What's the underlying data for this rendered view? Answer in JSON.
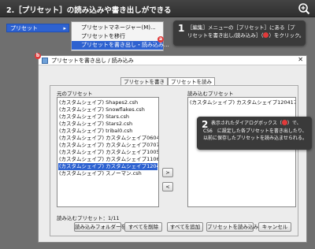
{
  "header": {
    "title": "2.［プリセット］の読み込みや書き出しができる"
  },
  "menu": {
    "trigger_label": "プリセット",
    "trigger_arrow": "▸",
    "items": [
      {
        "label": "プリセットマネージャー(M)..."
      },
      {
        "label": "プリセットを移行"
      },
      {
        "label": "プリセットを書き出し・読み込み..."
      }
    ],
    "badge_a": "a"
  },
  "callout1": {
    "number": "1",
    "line1": "［編集］メニューの［プリセット］にある［プ",
    "line2a": "リセットを書き出し/読み込み］（",
    "line2b": "）をクリック。"
  },
  "callout2": {
    "number": "2",
    "line1a": "表示されたダイアログボックス（",
    "line1b": "）で、",
    "line2": "CS6　に設定した各プリセットを書き出したり、",
    "line3": "以前に保存したプリセットを読み込ませられる。"
  },
  "dialog": {
    "badge_b": "b",
    "title": "プリセットを書き出し / 読み込み",
    "close_label": "✕",
    "tabs": [
      {
        "label": "プリセットを書き出し"
      },
      {
        "label": "プリセットを読み込み"
      }
    ],
    "left_label": "元のプリセット",
    "right_label": "読み込むプリセット",
    "left_list": [
      "(カスタムシェイプ) Shapes2.csh",
      "(カスタムシェイプ) Snowflakes.csh",
      "(カスタムシェイプ) Stars.csh",
      "(カスタムシェイプ) Stars2.csh",
      "(カスタムシェイプ) tribal0.csh",
      "(カスタムシェイプ) カスタムシェイプ0604.csh",
      "(カスタムシェイプ) カスタムシェイプ0707.csh",
      "(カスタムシェイプ) カスタムシェイプ1005.csh",
      "(カスタムシェイプ) カスタムシェイプ1106.csh",
      "(カスタムシェイプ) カスタムシェイプ120417.csh",
      "(カスタムシェイプ) スノーマン.csh"
    ],
    "right_list": [
      "(カスタムシェイプ) カスタムシェイプ120417.csh"
    ],
    "add_arrow": ">",
    "remove_arrow": "<",
    "status_text": "読み込むプリセット：1/11",
    "buttons": {
      "select_folder": "読み込みフォルダーを選択",
      "remove_all": "すべてを削除",
      "add_all": "すべてを追加",
      "import_presets": "プリセットを読み込み",
      "cancel": "キャンセル"
    }
  },
  "colors": {
    "accent": "#2e62d0",
    "badge": "#e03a3a",
    "callout_bg": "#3a3a3a",
    "page_bg": "#6f6f6f"
  }
}
